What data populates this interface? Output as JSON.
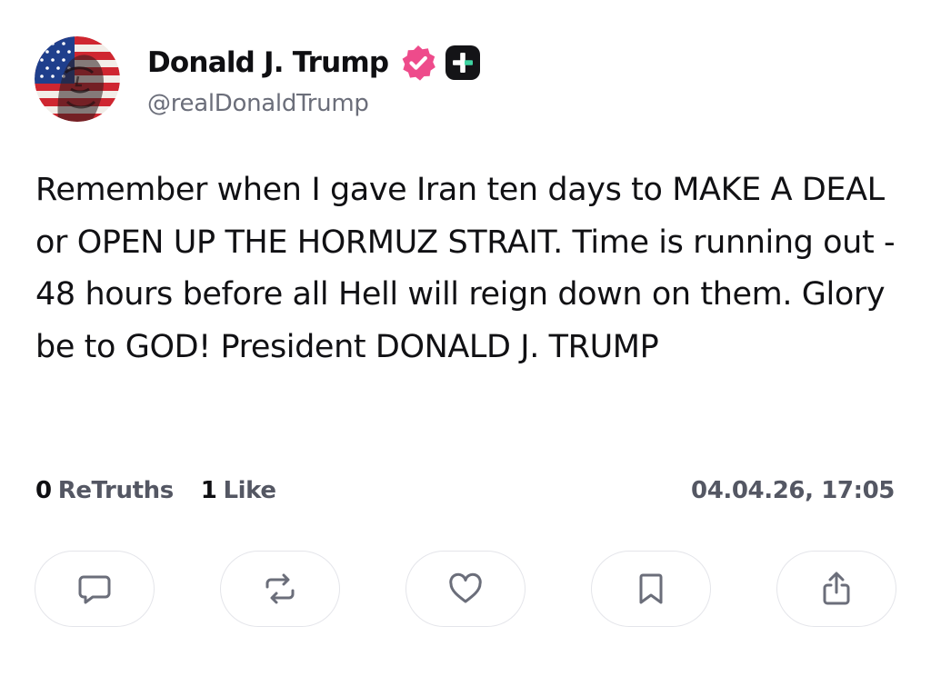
{
  "author": {
    "display_name": "Donald J. Trump",
    "handle": "@realDonaldTrump",
    "avatar_icon": "flag-portrait-avatar",
    "verified_icon": "verified-badge-icon",
    "badge_icon": "plus-badge-icon"
  },
  "post": {
    "text": "Remember when I gave Iran ten days to MAKE A DEAL or OPEN UP THE HORMUZ STRAIT. Time is running out - 48 hours before all Hell will reign down on them. Glory be to GOD! President DONALD J. TRUMP"
  },
  "stats": {
    "retruths_count": "0",
    "retruths_label": "ReTruths",
    "likes_count": "1",
    "likes_label": "Like",
    "timestamp": "04.04.26, 17:05"
  },
  "actions": [
    {
      "name": "reply",
      "icon": "comment-icon"
    },
    {
      "name": "retruth",
      "icon": "repost-icon"
    },
    {
      "name": "like",
      "icon": "heart-icon"
    },
    {
      "name": "bookmark",
      "icon": "bookmark-icon"
    },
    {
      "name": "share",
      "icon": "share-icon"
    }
  ],
  "colors": {
    "text_primary": "#0f0f12",
    "text_secondary": "#6b6e7a",
    "verified_pink": "#ee4b8b",
    "badge_dark": "#141417",
    "badge_green": "#3fd4a2",
    "icon_gray": "#6b6e7a",
    "button_border": "#e4e5ea"
  }
}
